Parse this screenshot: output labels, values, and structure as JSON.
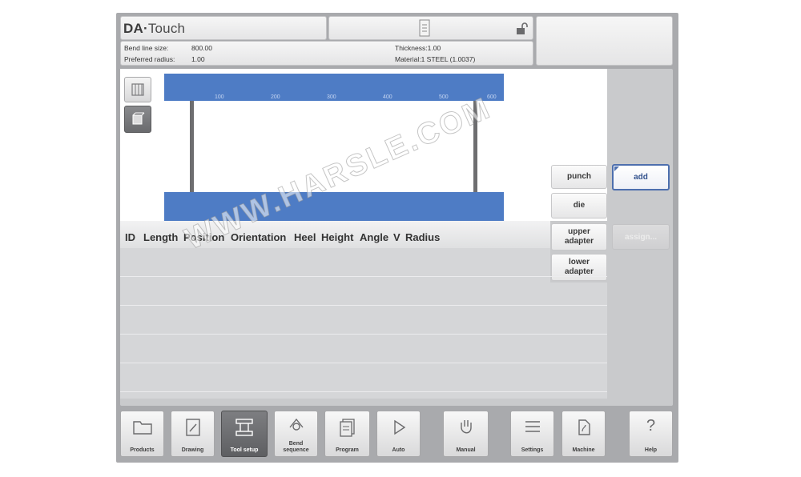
{
  "header": {
    "logo_prefix": "DA·",
    "logo_suffix": "Touch",
    "bend_line_label": "Bend line size:",
    "bend_line_value": "800.00",
    "preferred_radius_label": "Preferred radius:",
    "preferred_radius_value": "1.00",
    "thickness": "Thickness:1.00",
    "material": "Material:1 STEEL (1.0037)"
  },
  "ruler": {
    "ticks": [
      "100",
      "200",
      "300",
      "400",
      "500",
      "600"
    ]
  },
  "side_buttons": {
    "punch": "punch",
    "die": "die",
    "upper_adapter": "upper adapter",
    "lower_adapter": "lower adapter",
    "add": "add",
    "assign": "assign..."
  },
  "table": {
    "columns": [
      "ID",
      "Length",
      "Position",
      "Orientation",
      "Heel",
      "Height",
      "Angle",
      "V",
      "Radius"
    ]
  },
  "nav": {
    "items": [
      {
        "label": "Products",
        "icon": "folder-icon"
      },
      {
        "label": "Drawing",
        "icon": "drawing-icon"
      },
      {
        "label": "Tool setup",
        "icon": "tool-setup-icon"
      },
      {
        "label": "Bend sequence",
        "icon": "bend-sequence-icon"
      },
      {
        "label": "Program",
        "icon": "program-icon"
      },
      {
        "label": "Auto",
        "icon": "play-icon"
      },
      {
        "label": "Manual",
        "icon": "hand-icon"
      },
      {
        "label": "Settings",
        "icon": "settings-icon"
      },
      {
        "label": "Machine",
        "icon": "machine-icon"
      },
      {
        "label": "Help",
        "icon": "help-icon"
      }
    ],
    "active": "Tool setup"
  },
  "watermark": "WWW.HARSLE.COM",
  "colors": {
    "accent_blue": "#4e7cc5",
    "frame_gray": "#a9aaad",
    "add_border": "#4d6fae"
  }
}
